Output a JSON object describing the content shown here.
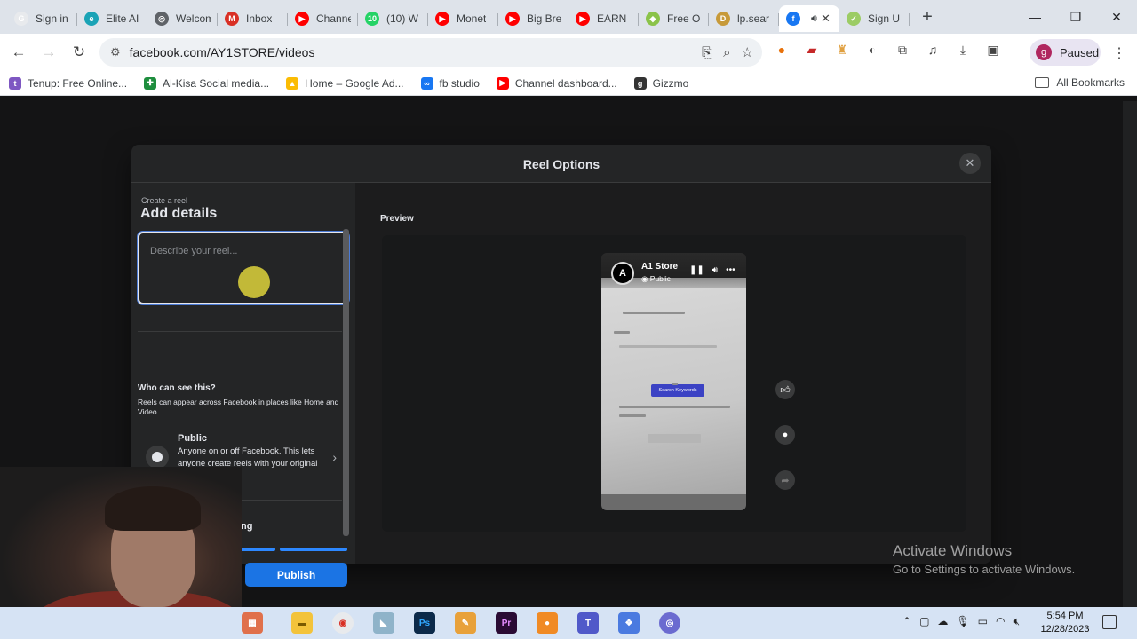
{
  "browser": {
    "tabs": [
      {
        "title": "Sign in",
        "color": "#e8eaed",
        "glyph": "G"
      },
      {
        "title": "Elite AI",
        "color": "#1aa3b6",
        "glyph": "e"
      },
      {
        "title": "Welcome",
        "color": "#5f6368",
        "glyph": "◎"
      },
      {
        "title": "Inbox",
        "color": "#d93025",
        "glyph": "M"
      },
      {
        "title": "Channel",
        "color": "#ff0000",
        "glyph": "▶"
      },
      {
        "title": "(10) W",
        "color": "#25d366",
        "glyph": "10"
      },
      {
        "title": "Monet",
        "color": "#ff0000",
        "glyph": "▶"
      },
      {
        "title": "Big Bre",
        "color": "#ff0000",
        "glyph": "▶"
      },
      {
        "title": "EARN",
        "color": "#ff0000",
        "glyph": "▶"
      },
      {
        "title": "Free O",
        "color": "#8bc34a",
        "glyph": "◆"
      },
      {
        "title": "lp.sear",
        "color": "#c79a3a",
        "glyph": "D"
      }
    ],
    "active_tab": {
      "title": "",
      "color": "#1877f2",
      "glyph": "f",
      "close": "✕"
    },
    "trailing_tab": {
      "title": "Sign U",
      "color": "#9ccc65",
      "glyph": "✓"
    },
    "new_tab": "+",
    "url": "facebook.com/AY1STORE/videos",
    "profile_initial": "g",
    "profile_status": "Paused",
    "bookmarks": [
      {
        "label": "Tenup: Free Online...",
        "color": "#7e57c2",
        "glyph": "t"
      },
      {
        "label": "Al-Kisa Social media...",
        "color": "#1e8e3e",
        "glyph": "✚"
      },
      {
        "label": "Home – Google Ad...",
        "color": "#fbbc04",
        "glyph": "▲"
      },
      {
        "label": "fb studio",
        "color": "#1877f2",
        "glyph": "∞"
      },
      {
        "label": "Channel dashboard...",
        "color": "#ff0000",
        "glyph": "▶"
      },
      {
        "label": "Gizzmo",
        "color": "#333333",
        "glyph": "g"
      }
    ],
    "all_bookmarks": "All Bookmarks"
  },
  "modal": {
    "title": "Reel Options",
    "close": "✕",
    "create_label": "Create a reel",
    "heading": "Add details",
    "description_placeholder": "Describe your reel...",
    "who_title": "Who can see this?",
    "who_desc": "Reels can appear across Facebook in places like Home and Video.",
    "audience": {
      "title": "Public",
      "desc": "Anyone on or off Facebook. This lets anyone create reels with your original audio."
    },
    "sharing_fragment": "ing",
    "publish": "Publish",
    "preview_label": "Preview"
  },
  "reel": {
    "page_name": "A1 Store",
    "visibility": "Public",
    "avatar_glyph": "A",
    "button_text": "Search Keywords",
    "side_icons": [
      "like-icon",
      "comment-icon",
      "share-icon"
    ]
  },
  "watermark": {
    "line1": "Activate Windows",
    "line2": "Go to Settings to activate Windows."
  },
  "taskbar": {
    "time": "5:54 PM",
    "date": "12/28/2023"
  },
  "colors": {
    "accent": "#1b74e4",
    "modal_bg": "#242526",
    "progress": "#2d88ff"
  }
}
